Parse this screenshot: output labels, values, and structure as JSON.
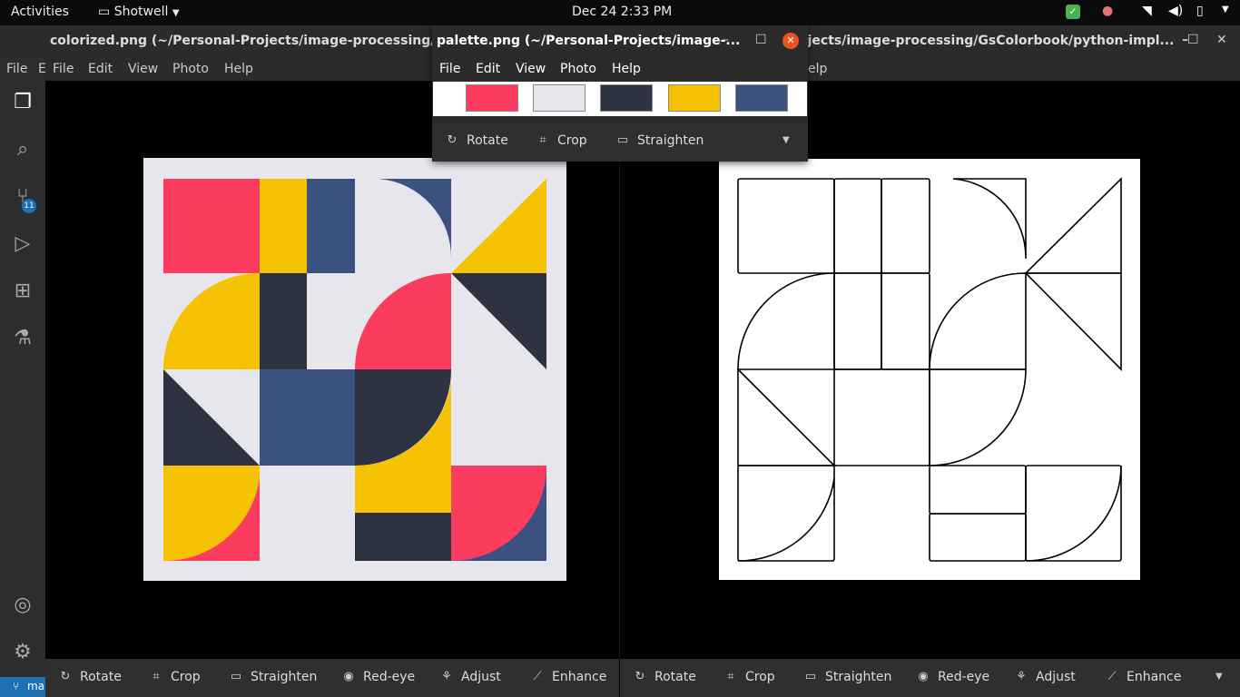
{
  "topbar": {
    "activities": "Activities",
    "app_name": "Shotwell",
    "datetime": "Dec 24  2:33 PM"
  },
  "vscode": {
    "menu_file": "File",
    "menu_edit": "E",
    "badge_count": "11",
    "status_branch": "ma"
  },
  "left_window": {
    "title": "colorized.png (~/Personal-Projects/image-processing/GsCol",
    "menu": [
      "File",
      "Edit",
      "View",
      "Photo",
      "Help"
    ],
    "toolbar": [
      "Rotate",
      "Crop",
      "Straighten",
      "Red-eye",
      "Adjust",
      "Enhance"
    ]
  },
  "right_window": {
    "title": "ojects/image-processing/GsColorbook/python-impl...",
    "menu_help_partial": "elp",
    "toolbar": [
      "Rotate",
      "Crop",
      "Straighten",
      "Red-eye",
      "Adjust",
      "Enhance"
    ]
  },
  "palette_window": {
    "title": "palette.png (~/Personal-Projects/image-...",
    "menu": [
      "File",
      "Edit",
      "View",
      "Photo",
      "Help"
    ],
    "toolbar": [
      "Rotate",
      "Crop",
      "Straighten"
    ],
    "swatches": [
      "#fc3c5f",
      "#e6e6ec",
      "#2d3340",
      "#f6c304",
      "#3b5280"
    ]
  },
  "colors": {
    "red": "#fc3c5f",
    "light": "#e6e6ec",
    "dark": "#2d3340",
    "yellow": "#f6c304",
    "blue": "#3b5280"
  }
}
